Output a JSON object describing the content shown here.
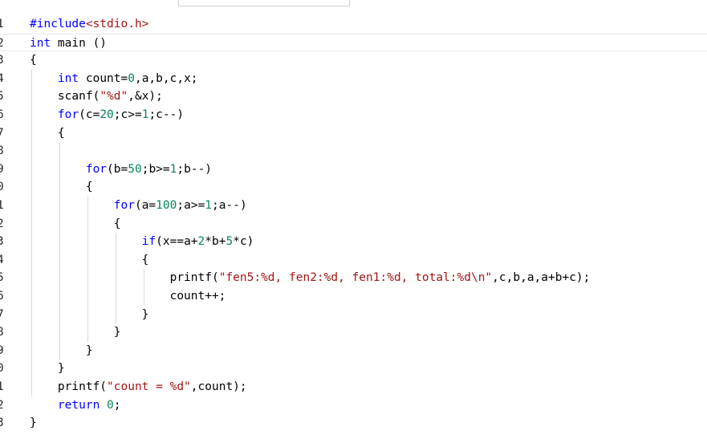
{
  "editor": {
    "lines": [
      {
        "num": "1",
        "tokens": [
          {
            "t": "#include",
            "c": "pre"
          },
          {
            "t": "<stdio.h>",
            "c": "inc"
          }
        ]
      },
      {
        "num": "2",
        "tokens": [
          {
            "t": "int",
            "c": "kw"
          },
          {
            "t": " main ()",
            "c": "def"
          }
        ]
      },
      {
        "num": "3",
        "tokens": [
          {
            "t": "{",
            "c": "def"
          }
        ]
      },
      {
        "num": "4",
        "tokens": [
          {
            "t": "    ",
            "c": "def"
          },
          {
            "t": "int",
            "c": "kw"
          },
          {
            "t": " count=",
            "c": "def"
          },
          {
            "t": "0",
            "c": "num"
          },
          {
            "t": ",a,b,c,x;",
            "c": "def"
          }
        ]
      },
      {
        "num": "5",
        "tokens": [
          {
            "t": "    scanf(",
            "c": "def"
          },
          {
            "t": "\"%d\"",
            "c": "str"
          },
          {
            "t": ",&x);",
            "c": "def"
          }
        ]
      },
      {
        "num": "6",
        "tokens": [
          {
            "t": "    ",
            "c": "def"
          },
          {
            "t": "for",
            "c": "kw"
          },
          {
            "t": "(c=",
            "c": "def"
          },
          {
            "t": "20",
            "c": "num"
          },
          {
            "t": ";c>=",
            "c": "def"
          },
          {
            "t": "1",
            "c": "num"
          },
          {
            "t": ";c--)",
            "c": "def"
          }
        ]
      },
      {
        "num": "7",
        "tokens": [
          {
            "t": "    {",
            "c": "def"
          }
        ]
      },
      {
        "num": "8",
        "tokens": []
      },
      {
        "num": "9",
        "tokens": [
          {
            "t": "        ",
            "c": "def"
          },
          {
            "t": "for",
            "c": "kw"
          },
          {
            "t": "(b=",
            "c": "def"
          },
          {
            "t": "50",
            "c": "num"
          },
          {
            "t": ";b>=",
            "c": "def"
          },
          {
            "t": "1",
            "c": "num"
          },
          {
            "t": ";b--)",
            "c": "def"
          }
        ]
      },
      {
        "num": "0",
        "tokens": [
          {
            "t": "        {",
            "c": "def"
          }
        ]
      },
      {
        "num": "1",
        "tokens": [
          {
            "t": "            ",
            "c": "def"
          },
          {
            "t": "for",
            "c": "kw"
          },
          {
            "t": "(a=",
            "c": "def"
          },
          {
            "t": "100",
            "c": "num"
          },
          {
            "t": ";a>=",
            "c": "def"
          },
          {
            "t": "1",
            "c": "num"
          },
          {
            "t": ";a--)",
            "c": "def"
          }
        ]
      },
      {
        "num": "2",
        "tokens": [
          {
            "t": "            {",
            "c": "def"
          }
        ]
      },
      {
        "num": "3",
        "tokens": [
          {
            "t": "                ",
            "c": "def"
          },
          {
            "t": "if",
            "c": "kw"
          },
          {
            "t": "(x==a+",
            "c": "def"
          },
          {
            "t": "2",
            "c": "num"
          },
          {
            "t": "*b+",
            "c": "def"
          },
          {
            "t": "5",
            "c": "num"
          },
          {
            "t": "*c)",
            "c": "def"
          }
        ]
      },
      {
        "num": "4",
        "tokens": [
          {
            "t": "                {",
            "c": "def"
          }
        ]
      },
      {
        "num": "5",
        "tokens": [
          {
            "t": "                    printf(",
            "c": "def"
          },
          {
            "t": "\"fen5:%d, fen2:%d, fen1:%d, total:%d\\n\"",
            "c": "str"
          },
          {
            "t": ",c,b,a,a+b+c);",
            "c": "def"
          }
        ]
      },
      {
        "num": "6",
        "tokens": [
          {
            "t": "                    count++;",
            "c": "def"
          }
        ]
      },
      {
        "num": "7",
        "tokens": [
          {
            "t": "                }",
            "c": "def"
          }
        ]
      },
      {
        "num": "8",
        "tokens": [
          {
            "t": "            }",
            "c": "def"
          }
        ]
      },
      {
        "num": "9",
        "tokens": [
          {
            "t": "        }",
            "c": "def"
          }
        ]
      },
      {
        "num": "0",
        "tokens": [
          {
            "t": "    }",
            "c": "def"
          }
        ]
      },
      {
        "num": "1",
        "tokens": [
          {
            "t": "    printf(",
            "c": "def"
          },
          {
            "t": "\"count = %d\"",
            "c": "str"
          },
          {
            "t": ",count);",
            "c": "def"
          }
        ]
      },
      {
        "num": "2",
        "tokens": [
          {
            "t": "    ",
            "c": "def"
          },
          {
            "t": "return",
            "c": "kw"
          },
          {
            "t": " ",
            "c": "def"
          },
          {
            "t": "0",
            "c": "num"
          },
          {
            "t": ";",
            "c": "def"
          }
        ]
      },
      {
        "num": "3",
        "tokens": [
          {
            "t": "}",
            "c": "def"
          }
        ]
      }
    ],
    "current_line": 1
  },
  "colors": {
    "keyword": "#0000ff",
    "preprocessor": "#0000ff",
    "include_path": "#a31515",
    "number": "#098658",
    "string": "#a31515",
    "default": "#000000",
    "background": "#ffffff"
  }
}
